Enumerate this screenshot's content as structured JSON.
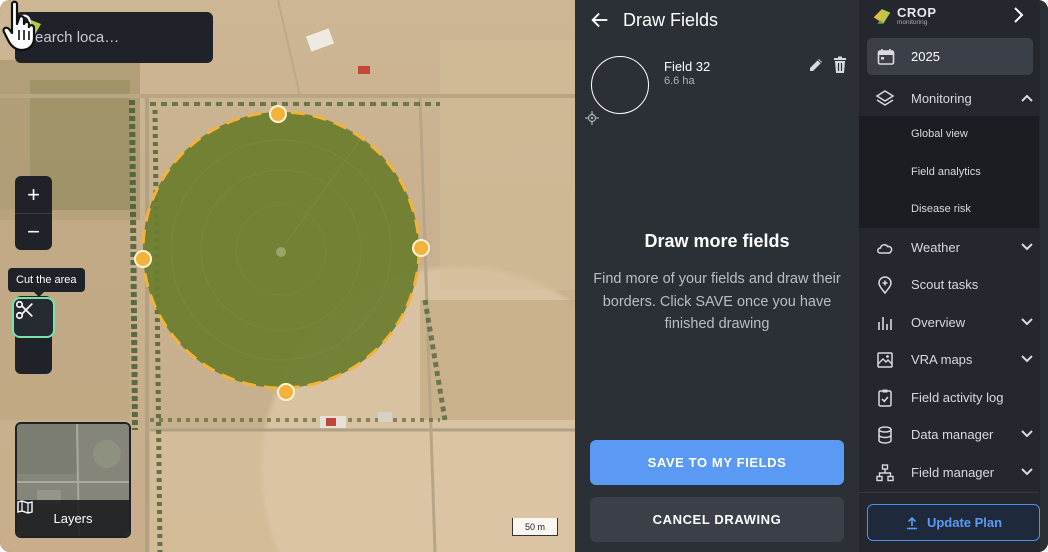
{
  "search": {
    "placeholder": "Search loca…"
  },
  "map": {
    "zoom_in": "+",
    "zoom_out": "−",
    "tooltip": "Cut the area",
    "layers_label": "Layers",
    "scale": "50 m"
  },
  "draw_panel": {
    "title": "Draw Fields",
    "field": {
      "name": "Field 32",
      "area": "6.6 ha"
    },
    "heading": "Draw more fields",
    "description": "Find more of your fields and draw their borders. Click SAVE once you have finished drawing",
    "save_label": "SAVE TO MY FIELDS",
    "cancel_label": "CANCEL DRAWING"
  },
  "sidebar": {
    "brand": "CROP",
    "brand_sub": "monitoring",
    "year": "2025",
    "monitoring": {
      "label": "Monitoring",
      "items": [
        "Global view",
        "Field analytics",
        "Disease risk"
      ]
    },
    "items": [
      {
        "label": "Weather",
        "icon": "cloud-icon",
        "expandable": true
      },
      {
        "label": "Scout tasks",
        "icon": "pin-plus-icon",
        "expandable": false
      },
      {
        "label": "Overview",
        "icon": "bar-chart-icon",
        "expandable": true
      },
      {
        "label": "VRA maps",
        "icon": "image-map-icon",
        "expandable": true
      },
      {
        "label": "Field activity log",
        "icon": "clipboard-check-icon",
        "expandable": false
      },
      {
        "label": "Data manager",
        "icon": "database-icon",
        "expandable": true
      },
      {
        "label": "Field manager",
        "icon": "hierarchy-icon",
        "expandable": true
      }
    ],
    "upgrade_label": "Update Plan"
  },
  "colors": {
    "accent": "#5a9af5",
    "field_fill": "#6b7d2e",
    "field_border": "#f3b33a",
    "cut_border": "#79e4a9"
  }
}
